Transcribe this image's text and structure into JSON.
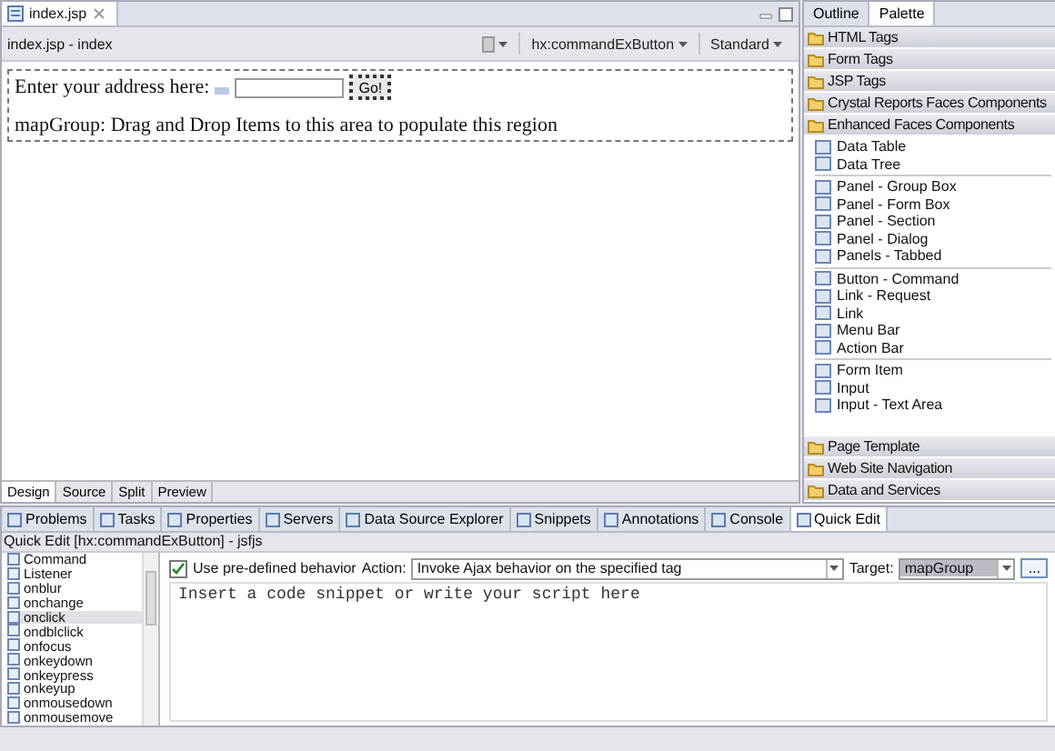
{
  "editor": {
    "tab": "index.jsp",
    "title": "index.jsp - index",
    "toolbar": {
      "component": "hx:commandExButton",
      "mode": "Standard"
    },
    "canvas": {
      "prompt": "Enter your address here:",
      "button": "Go!",
      "region_text": "mapGroup: Drag and Drop Items to this area to populate this region"
    },
    "view_tabs": [
      {
        "label": "Design",
        "selected": true
      },
      {
        "label": "Source",
        "selected": false
      },
      {
        "label": "Split",
        "selected": false
      },
      {
        "label": "Preview",
        "selected": false
      }
    ]
  },
  "palette": {
    "tabs": [
      {
        "label": "Outline",
        "selected": false
      },
      {
        "label": "Palette",
        "selected": true
      }
    ],
    "drawers_top": [
      "HTML Tags",
      "Form Tags",
      "JSP Tags",
      "Crystal Reports Faces Components"
    ],
    "open_drawer": {
      "label": "Enhanced Faces Components",
      "groups": [
        [
          "Data Table",
          "Data Tree"
        ],
        [
          "Panel - Group Box",
          "Panel - Form Box",
          "Panel - Section",
          "Panel - Dialog",
          "Panels - Tabbed"
        ],
        [
          "Button - Command",
          "Link - Request",
          "Link",
          "Menu Bar",
          "Action Bar"
        ],
        [
          "Form Item",
          "Input",
          "Input - Text Area"
        ]
      ]
    },
    "drawers_bottom": [
      "Page Template",
      "Web Site Navigation",
      "Data and Services"
    ]
  },
  "bottom": {
    "tabs": [
      {
        "label": "Problems",
        "selected": false
      },
      {
        "label": "Tasks",
        "selected": false
      },
      {
        "label": "Properties",
        "selected": false
      },
      {
        "label": "Servers",
        "selected": false
      },
      {
        "label": "Data Source Explorer",
        "selected": false
      },
      {
        "label": "Snippets",
        "selected": false
      },
      {
        "label": "Annotations",
        "selected": false
      },
      {
        "label": "Console",
        "selected": false
      },
      {
        "label": "Quick Edit",
        "selected": true
      }
    ],
    "title": "Quick Edit [hx:commandExButton] - jsfjs",
    "events": [
      {
        "label": "Command",
        "selected": false
      },
      {
        "label": "Listener",
        "selected": false
      },
      {
        "label": "onblur",
        "selected": false
      },
      {
        "label": "onchange",
        "selected": false
      },
      {
        "label": "onclick",
        "selected": true
      },
      {
        "label": "ondblclick",
        "selected": false
      },
      {
        "label": "onfocus",
        "selected": false
      },
      {
        "label": "onkeydown",
        "selected": false
      },
      {
        "label": "onkeypress",
        "selected": false
      },
      {
        "label": "onkeyup",
        "selected": false
      },
      {
        "label": "onmousedown",
        "selected": false
      },
      {
        "label": "onmousemove",
        "selected": false
      }
    ],
    "use_predefined": {
      "label": "Use pre-defined behavior",
      "checked": true
    },
    "action": {
      "label": "Action:",
      "value": "Invoke Ajax behavior on the specified tag"
    },
    "target": {
      "label": "Target:",
      "value": "mapGroup"
    },
    "more_button": "...",
    "code": {
      "placeholder": "Insert a code snippet or write your script here"
    }
  }
}
